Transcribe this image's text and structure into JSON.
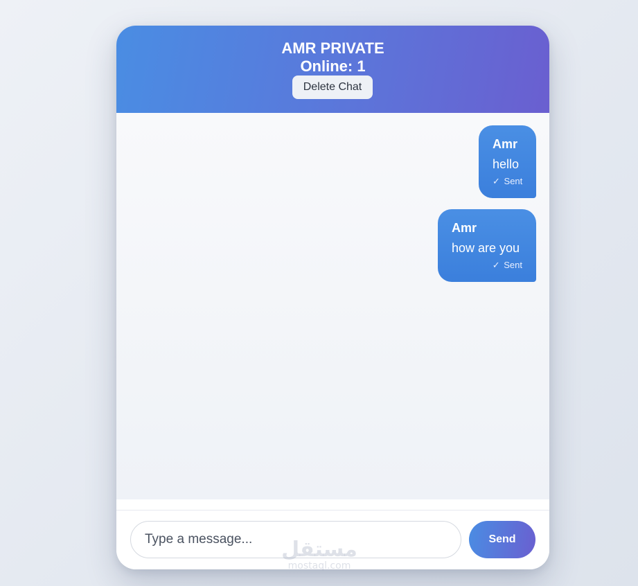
{
  "header": {
    "title": "AMR PRIVATE",
    "online": "Online: 1",
    "delete_label": "Delete Chat"
  },
  "messages": [
    {
      "sender": "Amr",
      "text": "hello",
      "status_icon": "✓",
      "status": "Sent"
    },
    {
      "sender": "Amr",
      "text": "how are you",
      "status_icon": "✓",
      "status": "Sent"
    }
  ],
  "composer": {
    "placeholder": "Type a message...",
    "send_label": "Send"
  },
  "watermark": {
    "arabic": "مستقل",
    "latin": "mostaql.com"
  },
  "colors": {
    "header_gradient_start": "#4a8de3",
    "header_gradient_end": "#6a5fd0",
    "bubble": "#3b7fdc",
    "background": "#eef1f6"
  }
}
